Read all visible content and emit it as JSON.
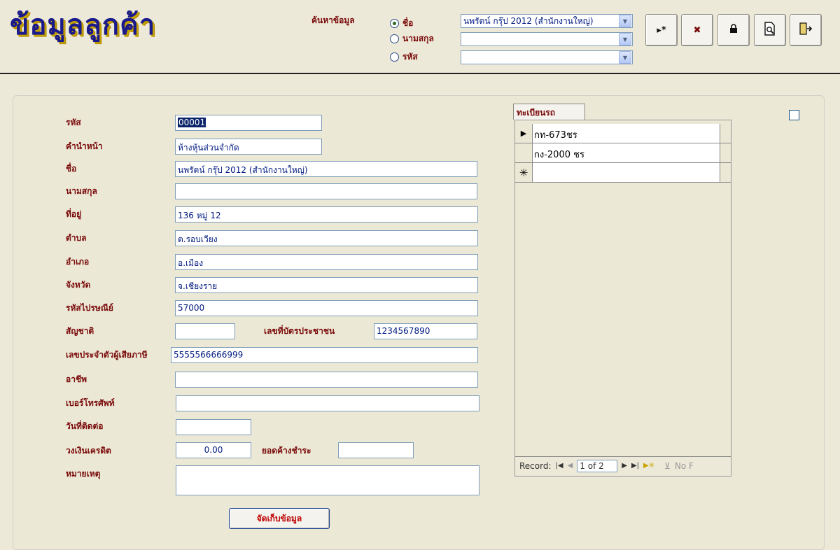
{
  "header": {
    "title": "ข้อมูลลูกค้า",
    "search_label": "ค้นหาข้อมูล",
    "radios": [
      {
        "label": "ชื่อ",
        "checked": true
      },
      {
        "label": "นามสกุล",
        "checked": false
      },
      {
        "label": "รหัส",
        "checked": false
      }
    ],
    "combos": [
      "นพรัตน์ กรุ๊ป 2012 (สำนักงานใหญ่)",
      "",
      ""
    ],
    "toolbar": [
      {
        "icon": "new-record-icon",
        "glyph": "▸*"
      },
      {
        "icon": "delete-record-icon",
        "glyph": "✖"
      },
      {
        "icon": "lock-icon",
        "glyph": "🔒"
      },
      {
        "icon": "print-preview-icon",
        "glyph": "🔍"
      },
      {
        "icon": "exit-icon",
        "glyph": "⇥"
      }
    ]
  },
  "form": {
    "code_label": "รหัส",
    "code": "00001",
    "prefix_label": "คำนำหน้า",
    "prefix": "ห้างหุ้นส่วนจำกัด",
    "name_label": "ชื่อ",
    "name": "นพรัตน์ กรุ๊ป 2012 (สำนักงานใหญ่)",
    "surname_label": "นามสกุล",
    "surname": "",
    "address_label": "ที่อยู่",
    "address": "136 หมู่ 12",
    "subdistrict_label": "ตำบล",
    "subdistrict": "ต.รอบเวียง",
    "district_label": "อำเภอ",
    "district": "อ.เมือง",
    "province_label": "จังหวัด",
    "province": "จ.เชียงราย",
    "postcode_label": "รหัสไปรษณีย์",
    "postcode": "57000",
    "nationality_label": "สัญชาติ",
    "nationality": "",
    "idcard_label": "เลขที่บัตรประชาชน",
    "idcard": "1234567890",
    "taxid_label": "เลขประจำตัวผู้เสียภาษี",
    "taxid": "5555566666999",
    "occupation_label": "อาชีพ",
    "occupation": "",
    "phone_label": "เบอร์โทรศัพท์",
    "phone": "",
    "contact_date_label": "วันที่ติดต่อ",
    "contact_date": "",
    "credit_label": "วงเงินเครดิต",
    "credit": "0.00",
    "balance_label": "ยอดค้างชำระ",
    "balance": "",
    "note_label": "หมายเหตุ",
    "note": "",
    "save_label": "จัดเก็บข้อมูล"
  },
  "subform": {
    "tab_label": "ทะเบียนรถ",
    "rows": [
      "กท-673ชร",
      "กง-2000 ชร"
    ],
    "nav": {
      "record_label": "Record:",
      "position": "1 of 2",
      "filter": "No F"
    }
  }
}
